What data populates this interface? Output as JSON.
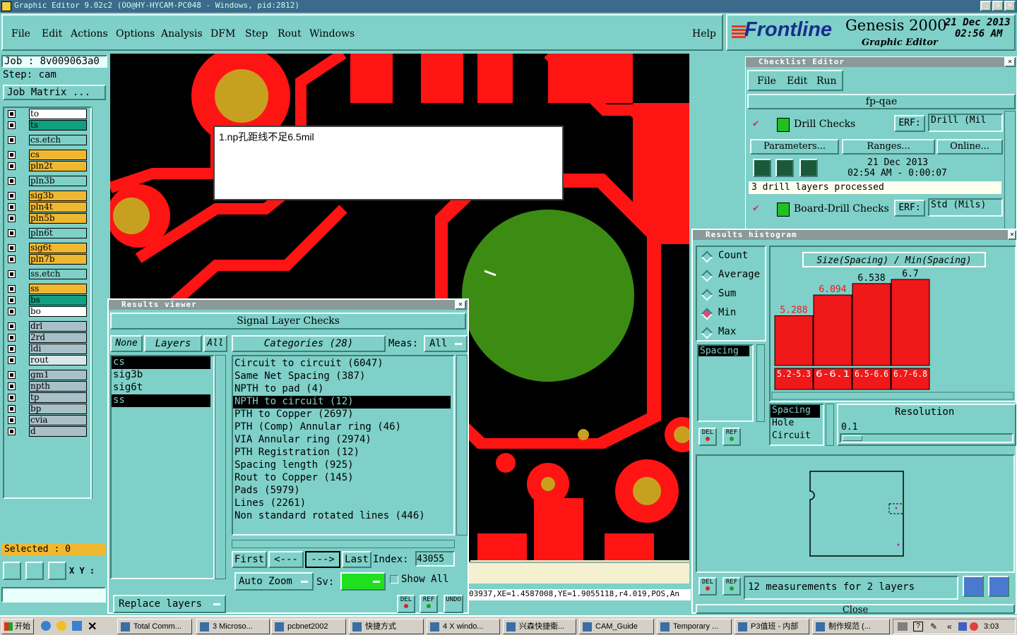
{
  "window": {
    "title": "Graphic Editor 9.02c2  (OO@HY-HYCAM-PC048 - Windows, pid:2812)"
  },
  "menu": {
    "items": [
      "File",
      "Edit",
      "Actions",
      "Options",
      "Analysis",
      "DFM",
      "Step",
      "Rout",
      "Windows"
    ],
    "help": "Help"
  },
  "brand": {
    "logo": "Frontline",
    "product": "Genesis 2000",
    "subtitle": "Graphic Editor",
    "date": "21 Dec 2013",
    "time": "02:56 AM"
  },
  "job": {
    "job": "Job  : 8v009063a0",
    "step": "Step: cam",
    "matrix_btn": "Job Matrix ..."
  },
  "layers": [
    {
      "name": "to",
      "color": "#ffffff"
    },
    {
      "name": "ts",
      "color": "#10a080"
    },
    {
      "name": "cs.etch",
      "color": "#7fd0c8"
    },
    {
      "name": "cs",
      "color": "#f0b830"
    },
    {
      "name": "pln2t",
      "color": "#f0b830"
    },
    {
      "name": "pln3b",
      "color": "#7fd0c8"
    },
    {
      "name": "sig3b",
      "color": "#f0b830"
    },
    {
      "name": "pln4t",
      "color": "#f0b830"
    },
    {
      "name": "pln5b",
      "color": "#f0b830"
    },
    {
      "name": "pln6t",
      "color": "#7fd0c8"
    },
    {
      "name": "sig6t",
      "color": "#f0b830"
    },
    {
      "name": "pln7b",
      "color": "#f0b830"
    },
    {
      "name": "ss.etch",
      "color": "#7fd0c8"
    },
    {
      "name": "ss",
      "color": "#f0b830"
    },
    {
      "name": "bs",
      "color": "#10a080"
    },
    {
      "name": "bo",
      "color": "#ffffff"
    },
    {
      "name": "drl",
      "color": "#a8c0c8"
    },
    {
      "name": "2rd",
      "color": "#a8c0c8"
    },
    {
      "name": "ldi",
      "color": "#a8c0c8"
    },
    {
      "name": "rout",
      "color": "#d8e8e8"
    },
    {
      "name": "gm1",
      "color": "#a8c0c8"
    },
    {
      "name": "npth",
      "color": "#a8c0c8"
    },
    {
      "name": "tp",
      "color": "#a8c0c8"
    },
    {
      "name": "bp",
      "color": "#a8c0c8"
    },
    {
      "name": "cvia",
      "color": "#a8c0c8"
    },
    {
      "name": "d",
      "color": "#a8c0c8"
    }
  ],
  "selected": "Selected : 0",
  "xy_label": "X Y :",
  "note": {
    "text": "1.np孔距线不足6.5mil"
  },
  "status_coords": "03937,XE=1.4587008,YE=1.9055118,r4.019,POS,An",
  "results_viewer": {
    "title": "Results viewer",
    "header": "Signal Layer Checks",
    "none_btn": "None",
    "layers_btn": "Layers",
    "all_btn": "All",
    "categories_label": "Categories (28)",
    "meas_label": "Meas:",
    "meas_value": "All",
    "layer_list": [
      "cs",
      "sig3b",
      "sig6t",
      "ss"
    ],
    "categories": [
      "Circuit to circuit (6047)",
      "Same Net Spacing (387)",
      "NPTH to pad (4)",
      "NPTH to circuit (12)",
      "PTH to Copper (2697)",
      "PTH (Comp) Annular ring (46)",
      "VIA Annular ring (2974)",
      "PTH Registration (12)",
      "Spacing length (925)",
      "Rout to Copper (145)",
      "Pads (5979)",
      "Lines (2261)",
      "Non standard rotated lines (446)"
    ],
    "selected_category": "NPTH to circuit (12)",
    "first": "First",
    "prev": "<---",
    "next": "--->",
    "last": "Last",
    "index_label": "Index:",
    "index_value": "43055",
    "auto_zoom": "Auto Zoom",
    "sv": "Sv:",
    "show_all": "Show All",
    "replace_layers": "Replace layers",
    "del": "DEL",
    "ref": "REF",
    "undo": "UNDO"
  },
  "checklist": {
    "title": "Checklist Editor",
    "menu": [
      "File",
      "Edit",
      "Run"
    ],
    "name": "fp-qae",
    "check1": {
      "name": "Drill Checks",
      "erf_label": "ERF:",
      "erf_value": "Drill (Mil"
    },
    "params": "Parameters...",
    "ranges": "Ranges...",
    "online": "Online...",
    "run_date": "21 Dec 2013",
    "run_time": "02:54 AM - 0:00:07",
    "status": "3 drill layers processed",
    "check2": {
      "name": "Board-Drill Checks",
      "erf_label": "ERF:",
      "erf_value": "Std (Mils)"
    }
  },
  "histogram": {
    "title": "Results histogram",
    "modes": [
      "Count",
      "Average",
      "Sum",
      "Min",
      "Max"
    ],
    "selected_mode": "Min",
    "measures": [
      "Spacing"
    ],
    "chart_title": "Size(Spacing) / Min(Spacing)",
    "bins": [
      "5.2-5.3",
      "6-6.1",
      "6.5-6.6",
      "6.7-6.8"
    ],
    "values": [
      "5.288",
      "6.094",
      "6.538",
      "6.7"
    ],
    "lower_list": [
      "Spacing",
      "Hole",
      "Circuit"
    ],
    "resolution_label": "Resolution",
    "resolution_value": "0.1",
    "measurements": "12 measurements for 2 layers",
    "close": "Close",
    "del": "DEL",
    "ref": "REF"
  },
  "chart_data": {
    "type": "bar",
    "title": "Size(Spacing) / Min(Spacing)",
    "categories": [
      "5.2-5.3",
      "6-6.1",
      "6.5-6.6",
      "6.7-6.8"
    ],
    "values": [
      5.288,
      6.094,
      6.538,
      6.7
    ],
    "ylim": [
      0,
      7
    ]
  },
  "taskbar": {
    "start": "开始",
    "tasks": [
      "Total Comm...",
      "3 Microso...",
      "pcbnet2002",
      "快捷方式",
      "4 X windo...",
      "兴森快捷衛...",
      "CAM_Guide",
      "Temporary ...",
      "P3值班 - 内部",
      "制作规范 (..."
    ],
    "clock": "3:03"
  }
}
